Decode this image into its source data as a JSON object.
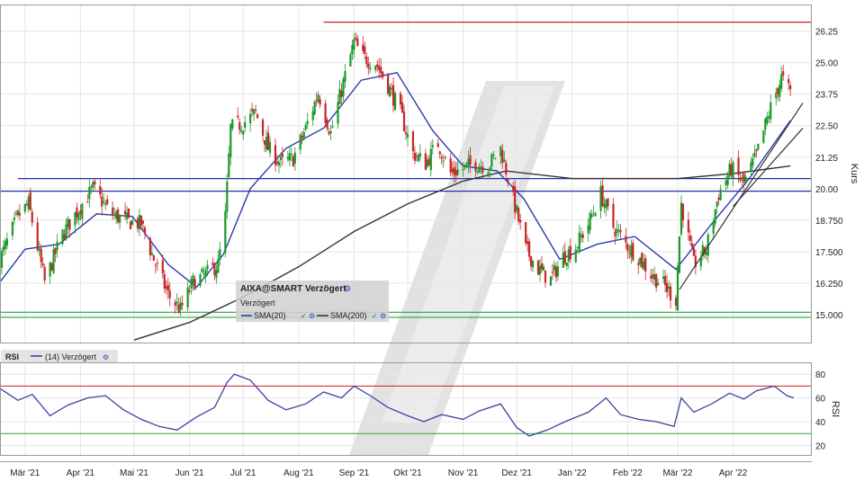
{
  "price_panel": {
    "legend_title": "AIXA@SMART Verzögert",
    "legend_subtitle": "Verzögert",
    "sma20_label": "SMA(20)",
    "sma200_label": "SMA(200)",
    "y_title": "Kurs"
  },
  "rsi_panel": {
    "label": "RSI",
    "series_label": "(14) Verzögert",
    "y_title": "RSI"
  },
  "colors": {
    "candle_up": "#1a9a2a",
    "candle_down": "#c8262a",
    "sma20": "#2b3bb0",
    "sma200": "#333333",
    "resistance": "#d02020",
    "support_blue": "#2030a0",
    "support_green": "#2aa040",
    "trendline": "#333333",
    "rsi_line": "#3a44a0",
    "grid": "#e6e6e6"
  },
  "chart_data": [
    {
      "type": "candlestick",
      "title": "AIXA@SMART Verzögert",
      "ylabel": "Kurs",
      "ylim": [
        13.9,
        27.3
      ],
      "y_ticks": [
        "26.25",
        "25.00",
        "23.75",
        "22.50",
        "21.25",
        "20.00",
        "18.750",
        "17.500",
        "16.250",
        "15.000"
      ],
      "y_tick_values": [
        26.25,
        25.0,
        23.75,
        22.5,
        21.25,
        20.0,
        18.75,
        17.5,
        16.25,
        15.0
      ],
      "x_ticks": [
        "Mär '21",
        "Apr '21",
        "Mai '21",
        "Jun '21",
        "Jul '21",
        "Aug '21",
        "Sep '21",
        "Okt '21",
        "Nov '21",
        "Dez '21",
        "Jan '22",
        "Feb '22",
        "Mär '22",
        "Apr '22"
      ],
      "x_tick_dates": [
        "2021-03-01",
        "2021-04-01",
        "2021-05-01",
        "2021-06-01",
        "2021-07-01",
        "2021-08-01",
        "2021-09-01",
        "2021-10-01",
        "2021-11-01",
        "2021-12-01",
        "2022-01-01",
        "2022-02-01",
        "2022-03-01",
        "2022-04-01"
      ],
      "x_range": [
        "2021-02-15",
        "2022-05-15"
      ],
      "grid": true,
      "close_series": [
        {
          "date": "2021-02-15",
          "close": 17.2
        },
        {
          "date": "2021-02-25",
          "close": 18.9
        },
        {
          "date": "2021-03-03",
          "close": 19.4
        },
        {
          "date": "2021-03-12",
          "close": 16.3
        },
        {
          "date": "2021-03-22",
          "close": 18.2
        },
        {
          "date": "2021-04-01",
          "close": 19.3
        },
        {
          "date": "2021-04-08",
          "close": 20.0
        },
        {
          "date": "2021-04-18",
          "close": 19.0
        },
        {
          "date": "2021-04-28",
          "close": 18.7
        },
        {
          "date": "2021-05-05",
          "close": 18.6
        },
        {
          "date": "2021-05-12",
          "close": 17.2
        },
        {
          "date": "2021-05-20",
          "close": 15.8
        },
        {
          "date": "2021-05-27",
          "close": 15.2
        },
        {
          "date": "2021-06-03",
          "close": 16.3
        },
        {
          "date": "2021-06-10",
          "close": 16.6
        },
        {
          "date": "2021-06-17",
          "close": 17.0
        },
        {
          "date": "2021-06-21",
          "close": 18.9
        },
        {
          "date": "2021-06-24",
          "close": 22.4
        },
        {
          "date": "2021-07-01",
          "close": 22.6
        },
        {
          "date": "2021-07-08",
          "close": 23.0
        },
        {
          "date": "2021-07-15",
          "close": 21.6
        },
        {
          "date": "2021-07-22",
          "close": 21.0
        },
        {
          "date": "2021-07-29",
          "close": 21.2
        },
        {
          "date": "2021-08-05",
          "close": 22.4
        },
        {
          "date": "2021-08-12",
          "close": 23.8
        },
        {
          "date": "2021-08-19",
          "close": 22.2
        },
        {
          "date": "2021-08-26",
          "close": 24.2
        },
        {
          "date": "2021-09-01",
          "close": 25.8
        },
        {
          "date": "2021-09-06",
          "close": 25.2
        },
        {
          "date": "2021-09-13",
          "close": 25.0
        },
        {
          "date": "2021-09-20",
          "close": 24.1
        },
        {
          "date": "2021-09-27",
          "close": 23.0
        },
        {
          "date": "2021-10-04",
          "close": 21.4
        },
        {
          "date": "2021-10-11",
          "close": 21.0
        },
        {
          "date": "2021-10-18",
          "close": 21.8
        },
        {
          "date": "2021-10-25",
          "close": 20.6
        },
        {
          "date": "2021-11-01",
          "close": 20.8
        },
        {
          "date": "2021-11-08",
          "close": 21.0
        },
        {
          "date": "2021-11-15",
          "close": 20.9
        },
        {
          "date": "2021-11-22",
          "close": 21.6
        },
        {
          "date": "2021-11-29",
          "close": 19.6
        },
        {
          "date": "2021-12-06",
          "close": 17.6
        },
        {
          "date": "2021-12-13",
          "close": 16.8
        },
        {
          "date": "2021-12-20",
          "close": 16.4
        },
        {
          "date": "2021-12-27",
          "close": 17.3
        },
        {
          "date": "2022-01-03",
          "close": 17.7
        },
        {
          "date": "2022-01-10",
          "close": 18.6
        },
        {
          "date": "2022-01-17",
          "close": 19.8
        },
        {
          "date": "2022-01-24",
          "close": 18.5
        },
        {
          "date": "2022-01-31",
          "close": 17.8
        },
        {
          "date": "2022-02-07",
          "close": 17.3
        },
        {
          "date": "2022-02-14",
          "close": 16.6
        },
        {
          "date": "2022-02-21",
          "close": 16.2
        },
        {
          "date": "2022-02-28",
          "close": 15.6
        },
        {
          "date": "2022-03-03",
          "close": 19.4
        },
        {
          "date": "2022-03-10",
          "close": 17.0
        },
        {
          "date": "2022-03-17",
          "close": 17.6
        },
        {
          "date": "2022-03-24",
          "close": 19.8
        },
        {
          "date": "2022-03-31",
          "close": 20.8
        },
        {
          "date": "2022-04-07",
          "close": 20.2
        },
        {
          "date": "2022-04-14",
          "close": 21.3
        },
        {
          "date": "2022-04-21",
          "close": 23.0
        },
        {
          "date": "2022-04-28",
          "close": 24.4
        },
        {
          "date": "2022-05-03",
          "close": 23.8
        }
      ],
      "series": [
        {
          "name": "SMA(20)",
          "color": "#2b3bb0",
          "points": [
            [
              "2021-02-15",
              16.3
            ],
            [
              "2021-03-01",
              17.6
            ],
            [
              "2021-03-20",
              17.8
            ],
            [
              "2021-04-10",
              19.0
            ],
            [
              "2021-04-30",
              18.9
            ],
            [
              "2021-05-20",
              17.0
            ],
            [
              "2021-06-05",
              16.1
            ],
            [
              "2021-06-20",
              17.4
            ],
            [
              "2021-07-05",
              20.0
            ],
            [
              "2021-07-25",
              21.6
            ],
            [
              "2021-08-15",
              22.4
            ],
            [
              "2021-09-05",
              24.3
            ],
            [
              "2021-09-25",
              24.6
            ],
            [
              "2021-10-15",
              22.3
            ],
            [
              "2021-11-01",
              20.9
            ],
            [
              "2021-11-20",
              20.7
            ],
            [
              "2021-12-05",
              19.6
            ],
            [
              "2021-12-25",
              17.2
            ],
            [
              "2022-01-15",
              17.8
            ],
            [
              "2022-02-05",
              18.1
            ],
            [
              "2022-02-28",
              16.8
            ],
            [
              "2022-03-20",
              18.6
            ],
            [
              "2022-04-10",
              20.4
            ],
            [
              "2022-05-03",
              22.7
            ]
          ]
        },
        {
          "name": "SMA(200)",
          "color": "#333333",
          "points": [
            [
              "2021-05-01",
              14.0
            ],
            [
              "2021-06-01",
              14.7
            ],
            [
              "2021-07-01",
              15.7
            ],
            [
              "2021-08-01",
              16.9
            ],
            [
              "2021-09-01",
              18.3
            ],
            [
              "2021-10-01",
              19.4
            ],
            [
              "2021-11-01",
              20.3
            ],
            [
              "2021-11-25",
              20.7
            ],
            [
              "2022-01-01",
              20.4
            ],
            [
              "2022-02-01",
              20.4
            ],
            [
              "2022-03-01",
              20.4
            ],
            [
              "2022-04-01",
              20.6
            ],
            [
              "2022-05-03",
              20.9
            ]
          ]
        }
      ],
      "horizontal_lines": [
        {
          "y": 26.6,
          "color": "#d02020",
          "from": "2021-08-15"
        },
        {
          "y": 20.4,
          "color": "#2030a0",
          "from": "2021-02-25"
        },
        {
          "y": 19.9,
          "color": "#2030a0",
          "from": "2021-02-15"
        },
        {
          "y": 15.1,
          "color": "#2aa040",
          "from": "2021-02-15"
        },
        {
          "y": 14.9,
          "color": "#2aa040",
          "from": "2021-02-15"
        }
      ],
      "trendlines": [
        {
          "start": [
            "2022-03-02",
            16.0
          ],
          "end": [
            "2022-05-10",
            23.4
          ],
          "color": "#333333"
        },
        {
          "start": [
            "2022-04-01",
            19.3
          ],
          "end": [
            "2022-05-10",
            22.4
          ],
          "color": "#333333"
        }
      ]
    },
    {
      "type": "line",
      "title": "RSI",
      "ylabel": "RSI",
      "ylim": [
        12,
        90
      ],
      "y_ticks": [
        "80",
        "60",
        "40",
        "20"
      ],
      "y_tick_values": [
        80,
        60,
        40,
        20
      ],
      "reference_lines": [
        {
          "y": 70,
          "color": "#d02020"
        },
        {
          "y": 30,
          "color": "#2aa040"
        }
      ],
      "series": [
        {
          "name": "(14) Verzögert",
          "color": "#3a44a0",
          "points": [
            [
              "2021-02-15",
              68
            ],
            [
              "2021-02-25",
              58
            ],
            [
              "2021-03-05",
              63
            ],
            [
              "2021-03-15",
              45
            ],
            [
              "2021-03-25",
              54
            ],
            [
              "2021-04-05",
              60
            ],
            [
              "2021-04-15",
              62
            ],
            [
              "2021-04-25",
              50
            ],
            [
              "2021-05-05",
              42
            ],
            [
              "2021-05-15",
              36
            ],
            [
              "2021-05-25",
              33
            ],
            [
              "2021-06-05",
              44
            ],
            [
              "2021-06-15",
              52
            ],
            [
              "2021-06-22",
              73
            ],
            [
              "2021-06-26",
              80
            ],
            [
              "2021-07-05",
              75
            ],
            [
              "2021-07-15",
              58
            ],
            [
              "2021-07-25",
              50
            ],
            [
              "2021-08-05",
              55
            ],
            [
              "2021-08-15",
              65
            ],
            [
              "2021-08-25",
              60
            ],
            [
              "2021-09-01",
              70
            ],
            [
              "2021-09-10",
              62
            ],
            [
              "2021-09-20",
              52
            ],
            [
              "2021-10-01",
              45
            ],
            [
              "2021-10-10",
              40
            ],
            [
              "2021-10-20",
              46
            ],
            [
              "2021-11-01",
              42
            ],
            [
              "2021-11-10",
              49
            ],
            [
              "2021-11-22",
              55
            ],
            [
              "2021-12-01",
              35
            ],
            [
              "2021-12-08",
              28
            ],
            [
              "2021-12-18",
              33
            ],
            [
              "2021-12-28",
              40
            ],
            [
              "2022-01-10",
              48
            ],
            [
              "2022-01-20",
              60
            ],
            [
              "2022-01-28",
              46
            ],
            [
              "2022-02-07",
              42
            ],
            [
              "2022-02-17",
              40
            ],
            [
              "2022-02-27",
              36
            ],
            [
              "2022-03-03",
              60
            ],
            [
              "2022-03-10",
              48
            ],
            [
              "2022-03-20",
              55
            ],
            [
              "2022-03-30",
              64
            ],
            [
              "2022-04-07",
              59
            ],
            [
              "2022-04-14",
              66
            ],
            [
              "2022-04-24",
              70
            ],
            [
              "2022-05-01",
              62
            ],
            [
              "2022-05-05",
              60
            ]
          ]
        }
      ]
    }
  ]
}
